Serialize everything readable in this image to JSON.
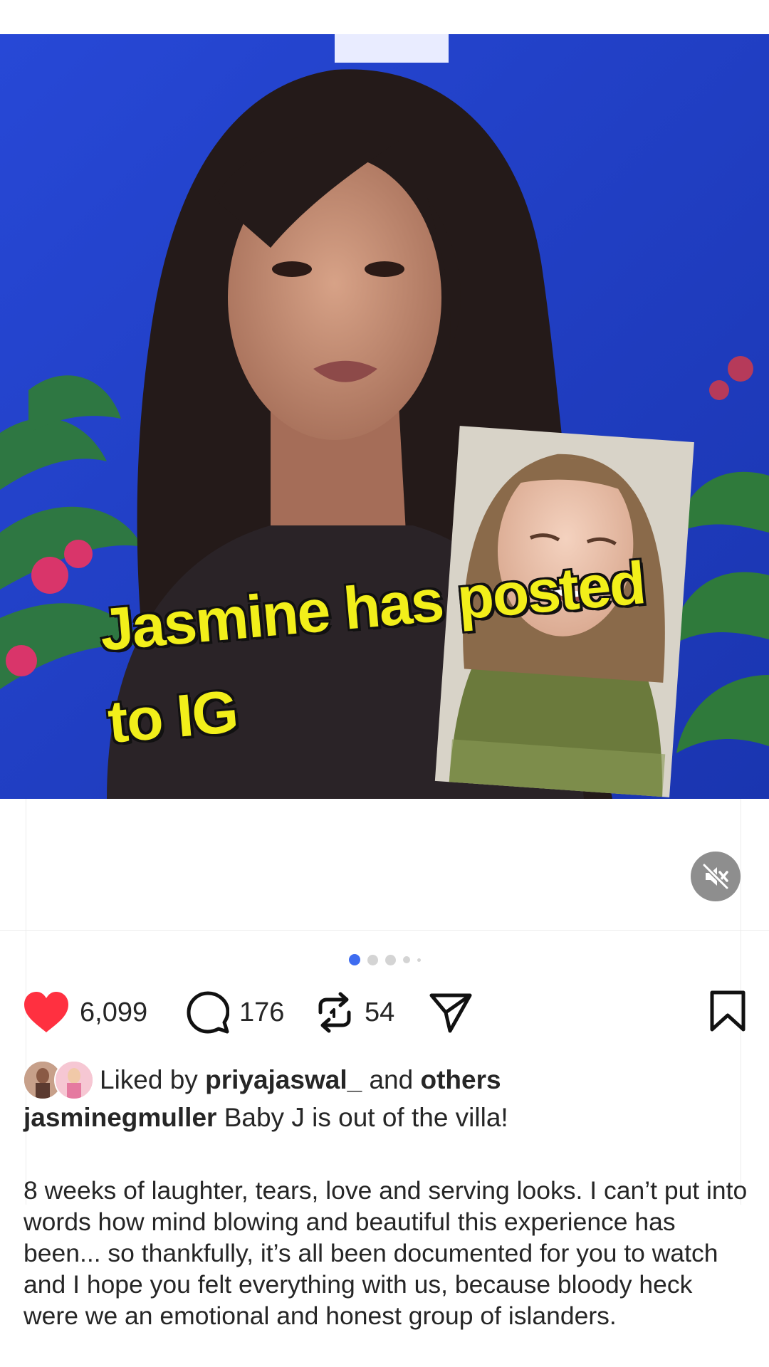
{
  "post": {
    "overlay_text": "Jasmine has posted to IG",
    "carousel": {
      "count": 5,
      "active_index": 0
    },
    "likes_count": "6,099",
    "comments_count": "176",
    "reposts_count": "54",
    "liked_by": {
      "prefix": "Liked by",
      "user": "priyajaswal_",
      "connector": "and",
      "others": "others"
    },
    "caption": {
      "username": "jasminegmuller",
      "headline": "Baby J is out of the villa!",
      "body": "8 weeks of laughter, tears, love and serving looks. I can’t put into words how mind blowing and beautiful this experience has been... so thankfully, it’s all been documented for you to watch and I hope you felt everything with us, because bloody heck were we an emotional and honest group of islanders."
    }
  },
  "icons": {
    "like": "heart-filled-icon",
    "comment": "comment-bubble-icon",
    "repost": "repost-icon",
    "share": "paper-plane-icon",
    "save": "bookmark-icon",
    "mute": "speaker-muted-icon"
  },
  "colors": {
    "like_red": "#ff3040",
    "media_blue": "#1f3fc4",
    "overlay_yellow": "#f2ef1a",
    "active_dot": "#3e6cf0"
  }
}
